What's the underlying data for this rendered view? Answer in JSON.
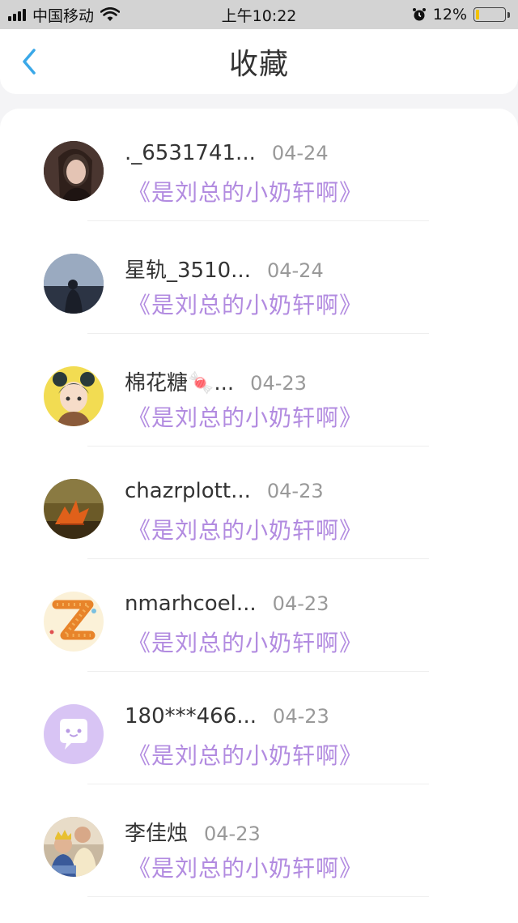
{
  "status_bar": {
    "carrier": "中国移动",
    "time": "上午10:22",
    "battery": "12%",
    "battery_level": 0.12
  },
  "header": {
    "title": "收藏"
  },
  "items": [
    {
      "name": "._6531741...",
      "date": "04-24",
      "subtitle": "《是刘总的小奶轩啊》",
      "avatar": "avatar-dark-portrait"
    },
    {
      "name": "星轨_3510...",
      "date": "04-24",
      "subtitle": "《是刘总的小奶轩啊》",
      "avatar": "avatar-window-silhouette"
    },
    {
      "name": "棉花糖🍬...",
      "date": "04-23",
      "subtitle": "《是刘总的小奶轩啊》",
      "avatar": "avatar-cartoon-girl"
    },
    {
      "name": "chazrplott...",
      "date": "04-23",
      "subtitle": "《是刘总的小奶轩啊》",
      "avatar": "avatar-autumn-leaf"
    },
    {
      "name": "nmarhcoel...",
      "date": "04-23",
      "subtitle": "《是刘总的小奶轩啊》",
      "avatar": "avatar-letter-z"
    },
    {
      "name": "180***466...",
      "date": "04-23",
      "subtitle": "《是刘总的小奶轩啊》",
      "avatar": "avatar-default-chat"
    },
    {
      "name": "李佳烛",
      "date": "04-23",
      "subtitle": "《是刘总的小奶轩啊》",
      "avatar": "avatar-child-photo"
    }
  ],
  "colors": {
    "accent": "#3aa8e8",
    "subtitle": "#b28be0",
    "date": "#999999"
  }
}
